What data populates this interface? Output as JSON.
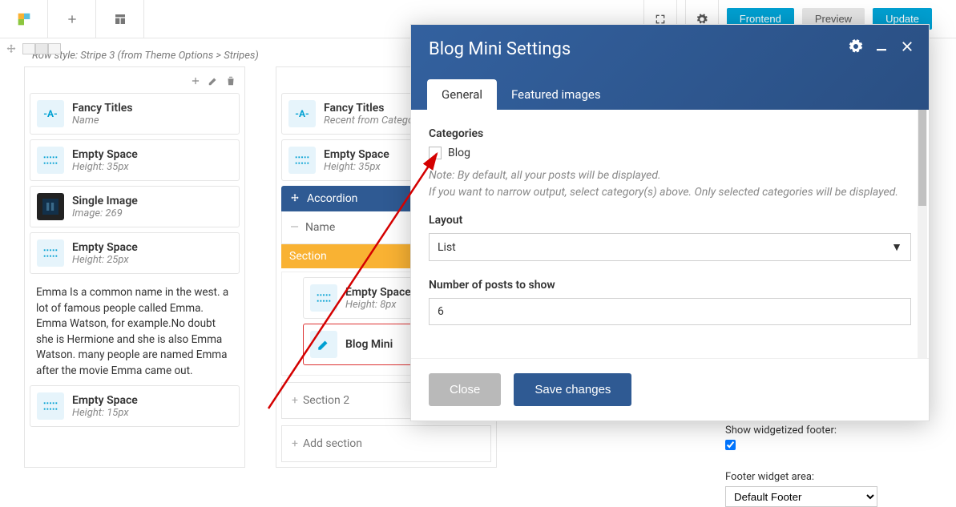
{
  "toolbar": {
    "frontend": "Frontend",
    "preview": "Preview",
    "update": "Update"
  },
  "row_hint": "Row style: Stripe 3 (from Theme Options > Stripes)",
  "col1": {
    "fancy": {
      "title": "Fancy Titles",
      "sub": "Name"
    },
    "es1": {
      "title": "Empty Space",
      "sub": "Height: 35px"
    },
    "img": {
      "title": "Single Image",
      "sub": "Image: 269"
    },
    "es2": {
      "title": "Empty Space",
      "sub": "Height: 25px"
    },
    "text": "Emma Is a common name in the west. a lot of famous people called Emma. Emma Watson, for example.No doubt she is Hermione and she is also Emma Watson. many people are named Emma after the movie Emma came out.",
    "es3": {
      "title": "Empty Space",
      "sub": "Height: 15px"
    }
  },
  "col2": {
    "fancy": {
      "title": "Fancy Titles",
      "sub": "Recent from Categor"
    },
    "es1": {
      "title": "Empty Space",
      "sub": "Height: 35px"
    },
    "accordion": "Accordion",
    "acc_name": "Name",
    "section": "Section",
    "es_inner": {
      "title": "Empty Space",
      "sub": "Height: 8px"
    },
    "blogmini": "Blog Mini",
    "section2": "Section 2",
    "add_section": "Add section"
  },
  "sidebar": {
    "widget_label": "Show widgetized footer:",
    "footer_label": "Footer widget area:",
    "footer_value": "Default Footer"
  },
  "modal": {
    "title": "Blog Mini Settings",
    "tab_general": "General",
    "tab_featured": "Featured images",
    "categories_label": "Categories",
    "cat_blog": "Blog",
    "note1": "Note: By default, all your posts will be displayed.",
    "note2": "If you want to narrow output, select category(s) above. Only selected categories will be displayed.",
    "layout_label": "Layout",
    "layout_value": "List",
    "posts_label": "Number of posts to show",
    "posts_value": "6",
    "close": "Close",
    "save": "Save changes"
  }
}
